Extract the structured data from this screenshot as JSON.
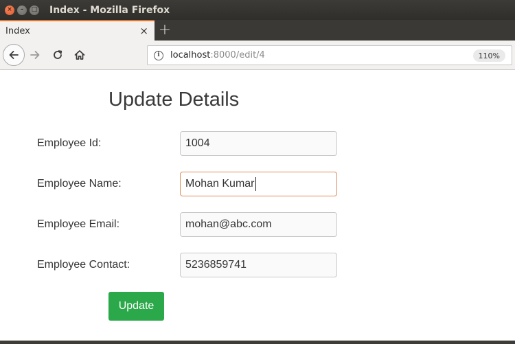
{
  "window": {
    "title": "Index - Mozilla Firefox",
    "close_glyph": "×",
    "min_glyph": "–",
    "max_glyph": "□"
  },
  "tab": {
    "label": "Index",
    "close_glyph": "×",
    "newtab_glyph": "+"
  },
  "navbar": {
    "url_host": "localhost",
    "url_rest": ":8000/edit/4",
    "zoom": "110%",
    "info_glyph": "i"
  },
  "form": {
    "heading": "Update Details",
    "fields": [
      {
        "label": "Employee Id:",
        "value": "1004"
      },
      {
        "label": "Employee Name:",
        "value": "Mohan Kumar"
      },
      {
        "label": "Employee Email:",
        "value": "mohan@abc.com"
      },
      {
        "label": "Employee Contact:",
        "value": "5236859741"
      }
    ],
    "submit_label": "Update",
    "submit_color": "#2ba84a"
  }
}
